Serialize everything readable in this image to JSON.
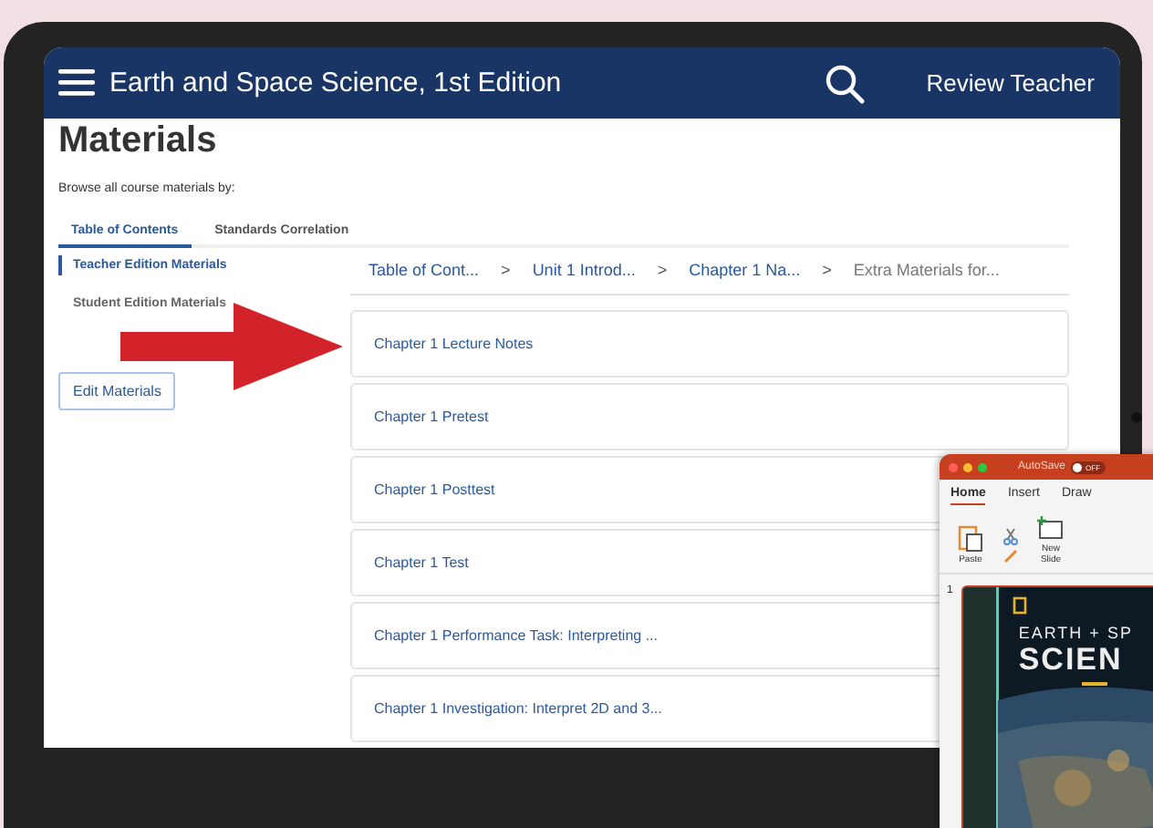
{
  "app": {
    "title": "Earth and Space Science, 1st Edition",
    "user": "Review Teacher"
  },
  "page": {
    "heading": "Materials",
    "browse_label": "Browse all course materials by:"
  },
  "tabs": [
    {
      "label": "Table of Contents",
      "selected": true
    },
    {
      "label": "Standards Correlation",
      "selected": false
    }
  ],
  "sidebar": {
    "items": [
      {
        "label": "Teacher Edition Materials",
        "selected": true
      },
      {
        "label": "Student Edition Materials",
        "selected": false
      }
    ],
    "edit_button": "Edit Materials"
  },
  "breadcrumb": {
    "separator": ">",
    "items": [
      {
        "label": "Table of Cont...",
        "current": false
      },
      {
        "label": "Unit 1 Introd...",
        "current": false
      },
      {
        "label": "Chapter 1 Na...",
        "current": false
      },
      {
        "label": "Extra Materials for...",
        "current": true
      }
    ]
  },
  "materials": [
    "Chapter 1 Lecture Notes",
    "Chapter 1 Pretest",
    "Chapter 1 Posttest",
    "Chapter 1 Test",
    "Chapter 1 Performance Task: Interpreting ...",
    "Chapter 1 Investigation: Interpret 2D and 3..."
  ],
  "powerpoint": {
    "autosave_label": "AutoSave",
    "autosave_state": "OFF",
    "autosave_on": false,
    "tabs": [
      {
        "label": "Home",
        "selected": true
      },
      {
        "label": "Insert",
        "selected": false
      },
      {
        "label": "Draw",
        "selected": false
      }
    ],
    "buttons": [
      {
        "kind": "paste",
        "label": "Paste"
      },
      {
        "kind": "new-slide",
        "label": "New Slide"
      }
    ],
    "slide_number": "1",
    "slide_title": [
      "EARTH + SP",
      "SCIEN"
    ]
  }
}
